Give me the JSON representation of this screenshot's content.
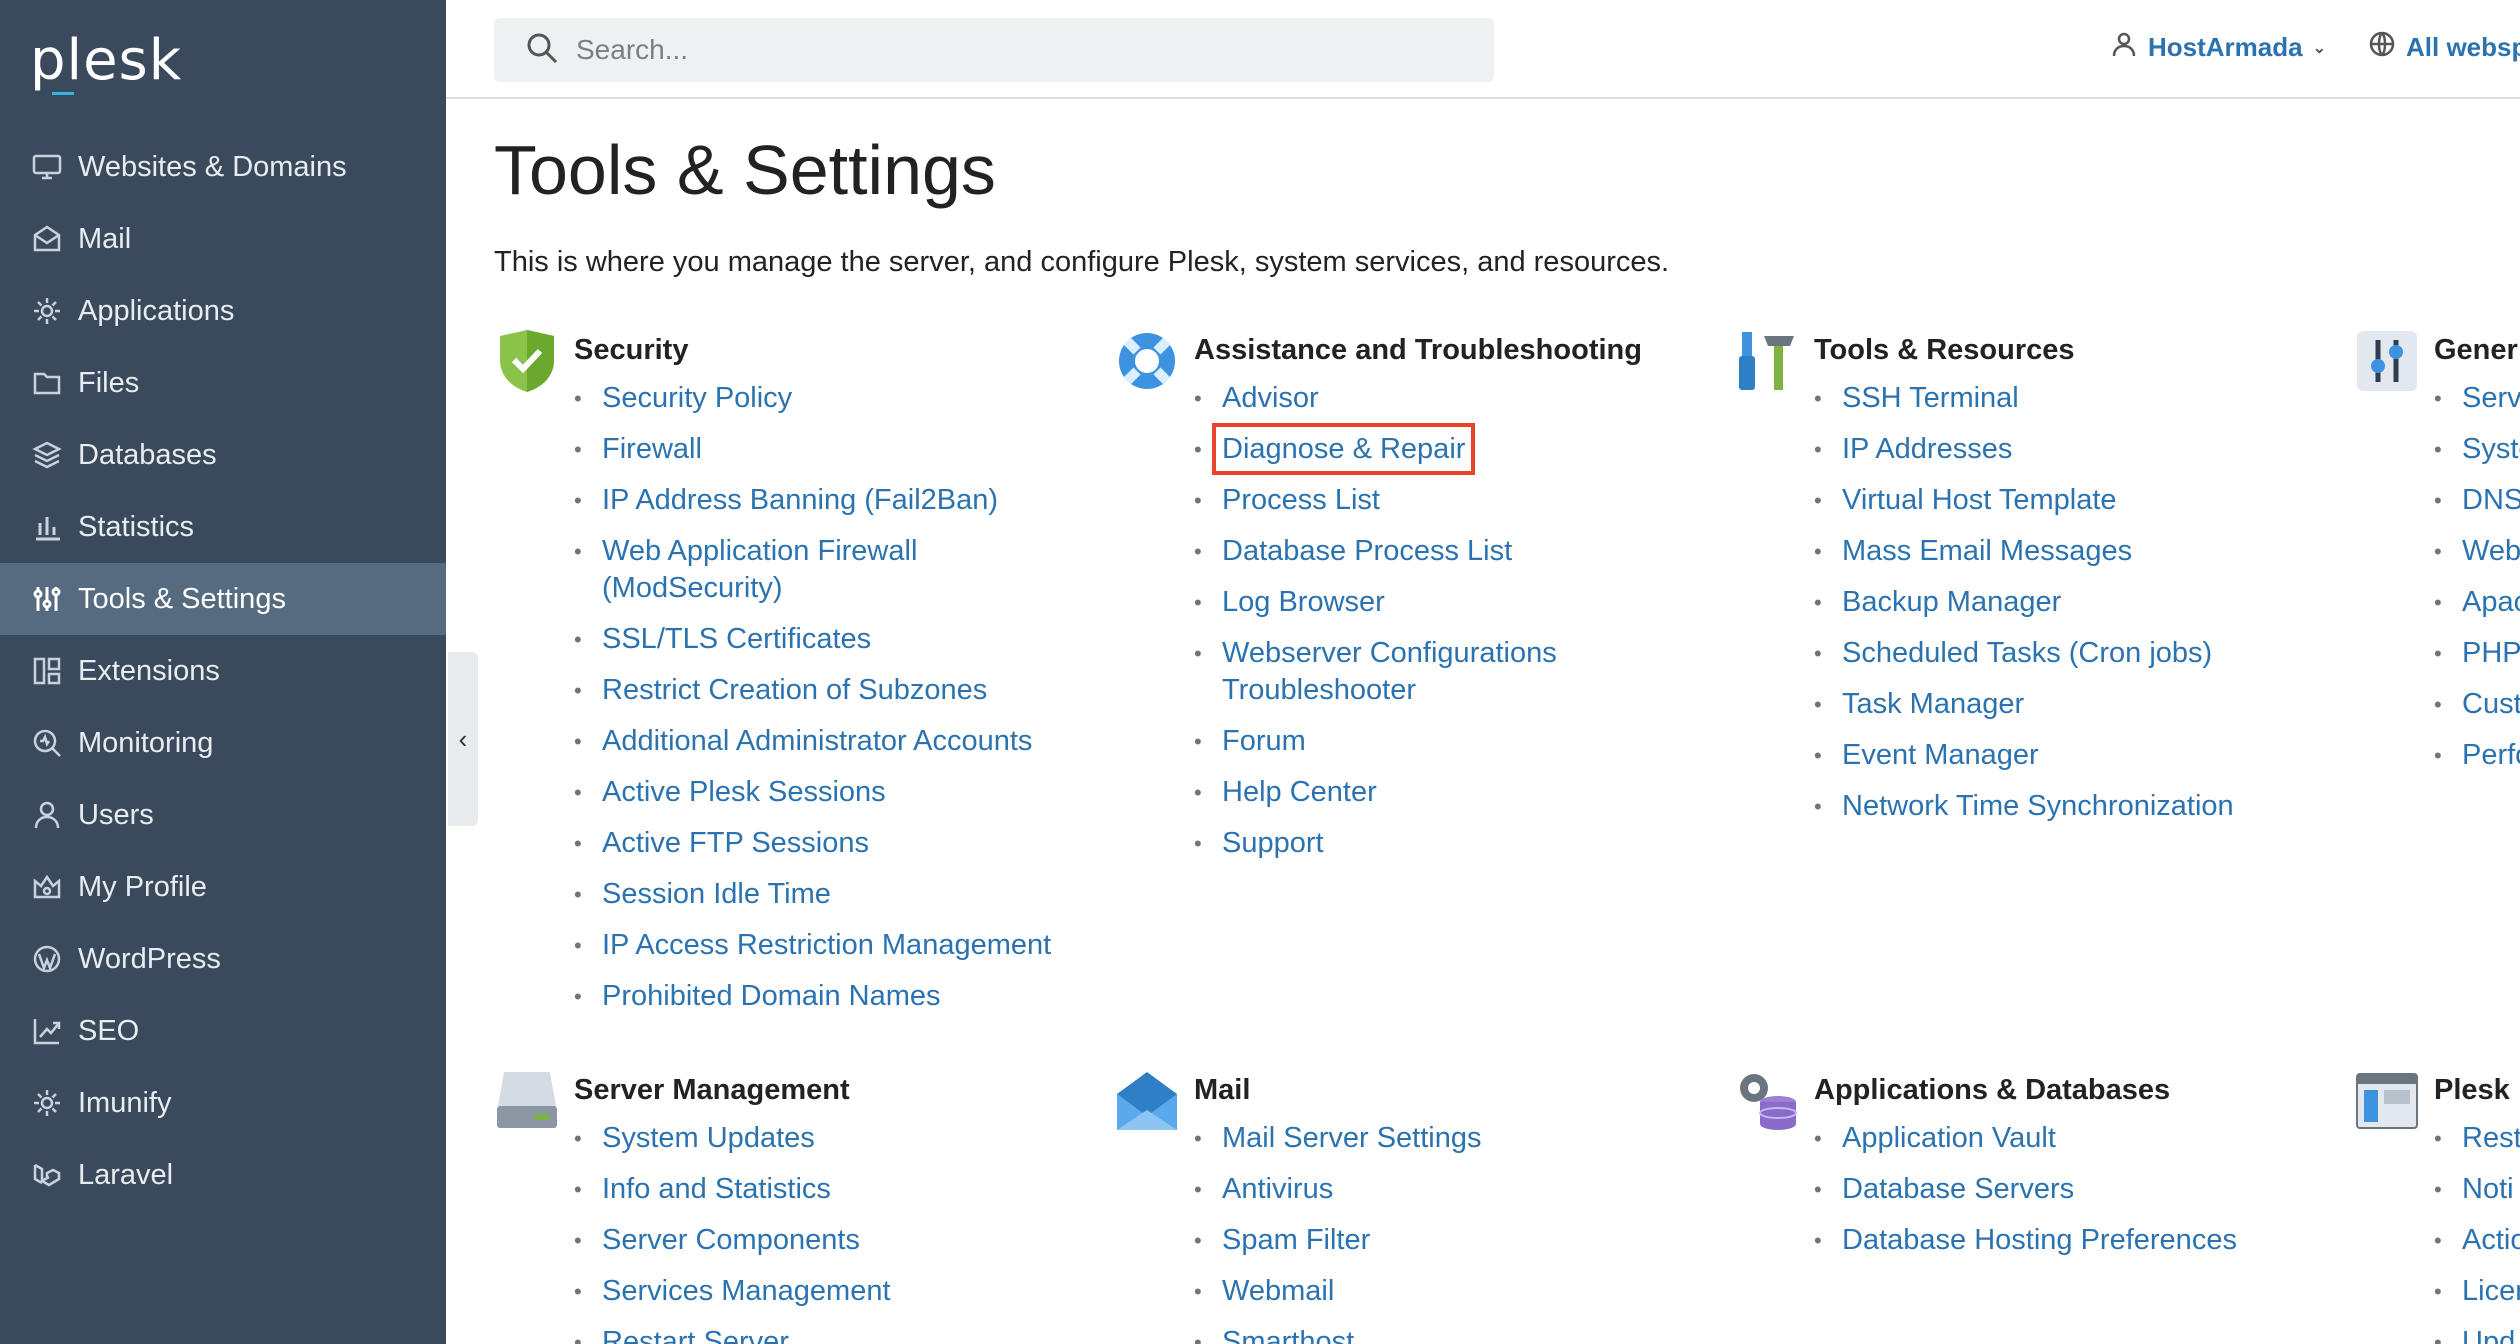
{
  "app": {
    "logo": "plesk"
  },
  "sidebar": {
    "items": [
      {
        "label": "Websites & Domains",
        "icon": "monitor-icon"
      },
      {
        "label": "Mail",
        "icon": "mail-icon"
      },
      {
        "label": "Applications",
        "icon": "gear-icon"
      },
      {
        "label": "Files",
        "icon": "folder-icon"
      },
      {
        "label": "Databases",
        "icon": "layers-icon"
      },
      {
        "label": "Statistics",
        "icon": "bar-chart-icon"
      },
      {
        "label": "Tools & Settings",
        "icon": "sliders-icon",
        "active": true
      },
      {
        "label": "Extensions",
        "icon": "grid-icon"
      },
      {
        "label": "Monitoring",
        "icon": "magnifier-icon"
      },
      {
        "label": "Users",
        "icon": "user-icon"
      },
      {
        "label": "My Profile",
        "icon": "crown-icon"
      },
      {
        "label": "WordPress",
        "icon": "wordpress-icon"
      },
      {
        "label": "SEO",
        "icon": "trend-icon"
      },
      {
        "label": "Imunify",
        "icon": "gear-icon"
      },
      {
        "label": "Laravel",
        "icon": "laravel-icon"
      }
    ]
  },
  "header": {
    "search_placeholder": "Search...",
    "user": "HostArmada",
    "webspaces": "All websp"
  },
  "main": {
    "title": "Tools & Settings",
    "description": "This is where you manage the server, and configure Plesk, system services, and resources."
  },
  "sections": {
    "security": {
      "title": "Security",
      "links": [
        "Security Policy",
        "Firewall",
        "IP Address Banning (Fail2Ban)",
        "Web Application Firewall (ModSecurity)",
        "SSL/TLS Certificates",
        "Restrict Creation of Subzones",
        "Additional Administrator Accounts",
        "Active Plesk Sessions",
        "Active FTP Sessions",
        "Session Idle Time",
        "IP Access Restriction Management",
        "Prohibited Domain Names"
      ]
    },
    "assistance": {
      "title": "Assistance and Troubleshooting",
      "links": [
        "Advisor",
        "Diagnose & Repair",
        "Process List",
        "Database Process List",
        "Log Browser",
        "Webserver Configurations Troubleshooter",
        "Forum",
        "Help Center",
        "Support"
      ]
    },
    "tools": {
      "title": "Tools & Resources",
      "links": [
        "SSH Terminal",
        "IP Addresses",
        "Virtual Host Template",
        "Mass Email Messages",
        "Backup Manager",
        "Scheduled Tasks (Cron jobs)",
        "Task Manager",
        "Event Manager",
        "Network Time Synchronization"
      ]
    },
    "general": {
      "title": "Gener",
      "links": [
        "Serv",
        "Syste",
        "DNS",
        "Web",
        "Apac",
        "PHP",
        "Cust",
        "Perfo"
      ]
    },
    "server": {
      "title": "Server Management",
      "links": [
        "System Updates",
        "Info and Statistics",
        "Server Components",
        "Services Management",
        "Restart Server"
      ]
    },
    "mail": {
      "title": "Mail",
      "links": [
        "Mail Server Settings",
        "Antivirus",
        "Spam Filter",
        "Webmail",
        "Smarthost"
      ]
    },
    "appsdb": {
      "title": "Applications & Databases",
      "links": [
        "Application Vault",
        "Database Servers",
        "Database Hosting Preferences"
      ]
    },
    "plesk": {
      "title": "Plesk",
      "links": [
        "Rest",
        "Noti",
        "Actio",
        "Licen",
        "Upd"
      ]
    }
  }
}
